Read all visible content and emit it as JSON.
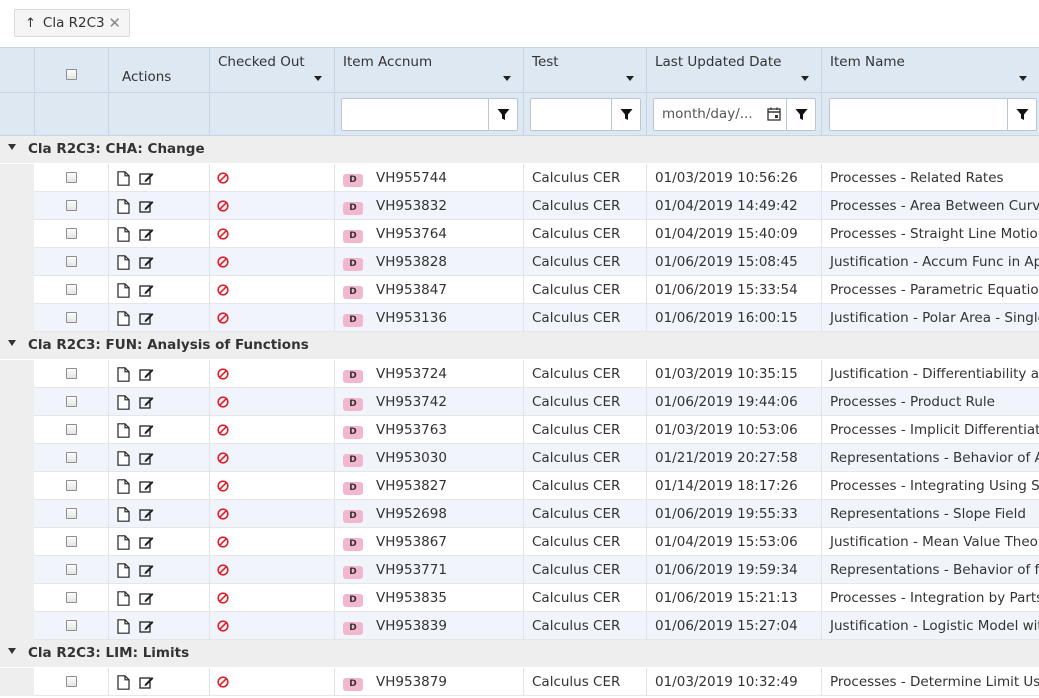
{
  "group_chip": {
    "arrow": "↑",
    "label": "Cla R2C3",
    "close": "✕"
  },
  "columns": {
    "actions": "Actions",
    "checked_out": "Checked Out",
    "item_accnum": "Item Accnum",
    "test": "Test",
    "last_updated": "Last Updated Date",
    "item_name": "Item Name"
  },
  "filters": {
    "item_accnum": "",
    "test": "",
    "last_updated_placeholder": "month/day/...",
    "item_name": ""
  },
  "badge_label": "D",
  "colors": {
    "header_bg": "#dde8f3",
    "group_bg": "#eeeeee",
    "alt_row": "#f1f4fb",
    "badge": "#f2b6cf",
    "no_icon": "#e0202a"
  },
  "groups": [
    {
      "label": "Cla R2C3: CHA: Change",
      "rows": [
        {
          "accnum": "VH955744",
          "test": "Calculus CER",
          "date": "01/03/2019 10:56:26",
          "name": "Processes - Related Rates"
        },
        {
          "accnum": "VH953832",
          "test": "Calculus CER",
          "date": "01/04/2019 14:49:42",
          "name": "Processes - Area Between Curve"
        },
        {
          "accnum": "VH953764",
          "test": "Calculus CER",
          "date": "01/04/2019 15:40:09",
          "name": "Processes - Straight Line Motior"
        },
        {
          "accnum": "VH953828",
          "test": "Calculus CER",
          "date": "01/06/2019 15:08:45",
          "name": "Justification - Accum Func in App"
        },
        {
          "accnum": "VH953847",
          "test": "Calculus CER",
          "date": "01/06/2019 15:33:54",
          "name": "Processes - Parametric Equatior"
        },
        {
          "accnum": "VH953136",
          "test": "Calculus CER",
          "date": "01/06/2019 16:00:15",
          "name": "Justification - Polar Area - Single"
        }
      ]
    },
    {
      "label": "Cla R2C3: FUN: Analysis of Functions",
      "rows": [
        {
          "accnum": "VH953724",
          "test": "Calculus CER",
          "date": "01/03/2019 10:35:15",
          "name": "Justification - Differentiability ar"
        },
        {
          "accnum": "VH953742",
          "test": "Calculus CER",
          "date": "01/06/2019 19:44:06",
          "name": "Processes - Product Rule"
        },
        {
          "accnum": "VH953763",
          "test": "Calculus CER",
          "date": "01/03/2019 10:53:06",
          "name": "Processes - Implicit Differentiati"
        },
        {
          "accnum": "VH953030",
          "test": "Calculus CER",
          "date": "01/21/2019 20:27:58",
          "name": "Representations - Behavior of A"
        },
        {
          "accnum": "VH953827",
          "test": "Calculus CER",
          "date": "01/14/2019 18:17:26",
          "name": "Processes - Integrating Using Su"
        },
        {
          "accnum": "VH952698",
          "test": "Calculus CER",
          "date": "01/06/2019 19:55:33",
          "name": "Representations - Slope Field"
        },
        {
          "accnum": "VH953867",
          "test": "Calculus CER",
          "date": "01/04/2019 15:53:06",
          "name": "Justification - Mean Value Theor"
        },
        {
          "accnum": "VH953771",
          "test": "Calculus CER",
          "date": "01/06/2019 19:59:34",
          "name": "Representations - Behavior of f"
        },
        {
          "accnum": "VH953835",
          "test": "Calculus CER",
          "date": "01/06/2019 15:21:13",
          "name": "Processes - Integration by Parts"
        },
        {
          "accnum": "VH953839",
          "test": "Calculus CER",
          "date": "01/06/2019 15:27:04",
          "name": "Justification - Logistic Model witl"
        }
      ]
    },
    {
      "label": "Cla R2C3: LIM: Limits",
      "rows": [
        {
          "accnum": "VH953879",
          "test": "Calculus CER",
          "date": "01/03/2019 10:32:49",
          "name": "Processes - Determine Limit Usi"
        }
      ]
    }
  ]
}
